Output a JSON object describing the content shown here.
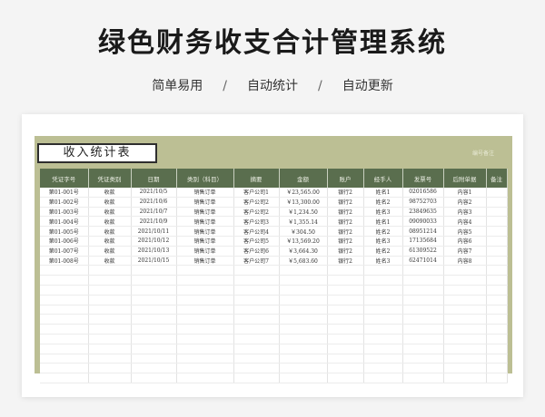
{
  "page": {
    "title": "绿色财务收支合计管理系统",
    "subtitle": [
      "简单易用",
      "自动统计",
      "自动更新"
    ],
    "separator": "/"
  },
  "sheet": {
    "label": "收入统计表",
    "watermark": "编号备注"
  },
  "table": {
    "columns": [
      "凭证字号",
      "凭证类别",
      "日期",
      "类别（科目）",
      "摘要",
      "金额",
      "账户",
      "经手人",
      "发票号",
      "后附单据",
      "备注"
    ],
    "rows": [
      [
        "第01-001号",
        "收款",
        "2021/10/5",
        "销售订单",
        "客户公司1",
        "￥23,565.00",
        "银行2",
        "姓名1",
        "02016586",
        "内容1",
        ""
      ],
      [
        "第01-002号",
        "收款",
        "2021/10/6",
        "销售订单",
        "客户公司2",
        "￥13,300.00",
        "银行2",
        "姓名2",
        "98752703",
        "内容2",
        ""
      ],
      [
        "第01-003号",
        "收款",
        "2021/10/7",
        "销售订单",
        "客户公司2",
        "￥1,234.50",
        "银行2",
        "姓名3",
        "23849635",
        "内容3",
        ""
      ],
      [
        "第01-004号",
        "收款",
        "2021/10/9",
        "销售订单",
        "客户公司3",
        "￥1,355.14",
        "银行2",
        "姓名1",
        "09090033",
        "内容4",
        ""
      ],
      [
        "第01-005号",
        "收款",
        "2021/10/11",
        "销售订单",
        "客户公司4",
        "￥304.50",
        "银行2",
        "姓名2",
        "08951214",
        "内容5",
        ""
      ],
      [
        "第01-006号",
        "收款",
        "2021/10/12",
        "销售订单",
        "客户公司5",
        "￥13,569.20",
        "银行2",
        "姓名3",
        "17135684",
        "内容6",
        ""
      ],
      [
        "第01-007号",
        "收款",
        "2021/10/13",
        "销售订单",
        "客户公司6",
        "￥3,664.30",
        "银行2",
        "姓名2",
        "61309522",
        "内容7",
        ""
      ],
      [
        "第01-008号",
        "收款",
        "2021/10/15",
        "销售订单",
        "客户公司7",
        "￥5,683.60",
        "银行2",
        "姓名3",
        "62471014",
        "内容8",
        ""
      ]
    ],
    "empty_rows": 12
  }
}
